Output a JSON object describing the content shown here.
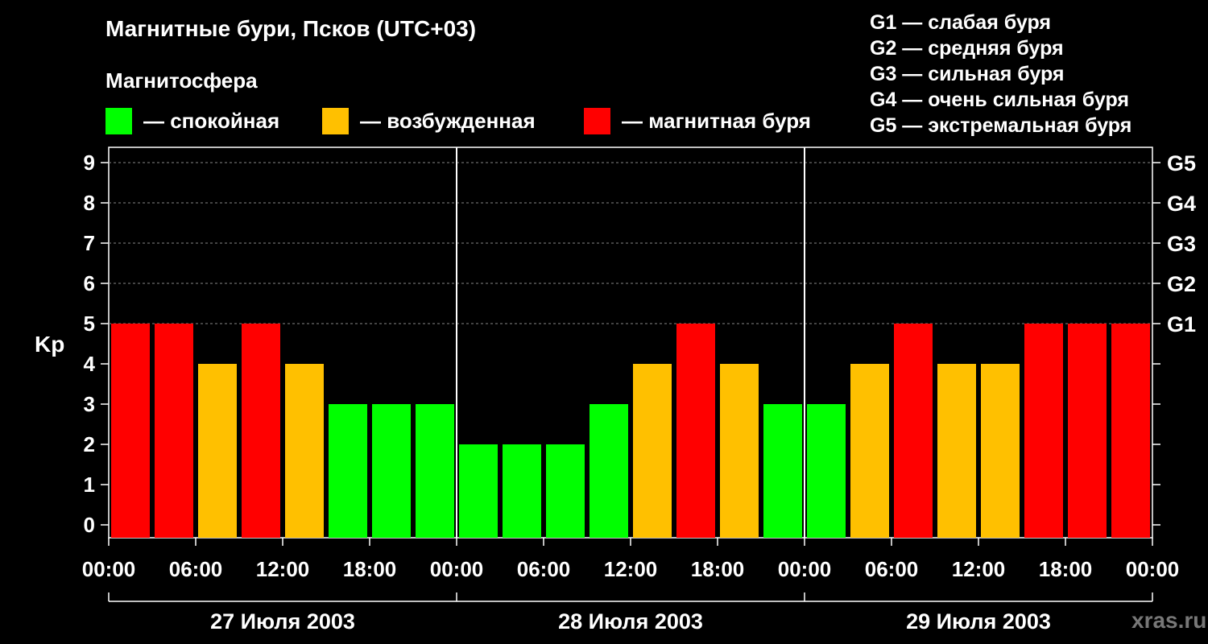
{
  "header": {
    "title": "Магнитные бури, Псков (UTC+03)",
    "magnetosphere_label": "Магнитосфера"
  },
  "legend": {
    "items": [
      {
        "label": "— спокойная",
        "color": "#00ff00"
      },
      {
        "label": "— возбужденная",
        "color": "#ffc000"
      },
      {
        "label": "— магнитная буря",
        "color": "#ff0000"
      }
    ],
    "storm_levels": [
      "G1 — слабая буря",
      "G2 — средняя буря",
      "G3 — сильная буря",
      "G4 — очень сильная буря",
      "G5 — экстремальная буря"
    ]
  },
  "watermark": "xras.ru",
  "colors": {
    "quiet": "#00ff00",
    "active": "#ffc000",
    "storm": "#ff0000",
    "background": "#000000"
  },
  "chart_data": {
    "type": "bar",
    "ylabel": "Kp",
    "ylim": [
      0,
      9
    ],
    "yticks": [
      "0",
      "1",
      "2",
      "3",
      "4",
      "5",
      "6",
      "7",
      "8",
      "9"
    ],
    "g_ticks": [
      {
        "kp": 5,
        "label": "G1"
      },
      {
        "kp": 6,
        "label": "G2"
      },
      {
        "kp": 7,
        "label": "G3"
      },
      {
        "kp": 8,
        "label": "G4"
      },
      {
        "kp": 9,
        "label": "G5"
      }
    ],
    "xticks": [
      "00:00",
      "06:00",
      "12:00",
      "18:00",
      "00:00",
      "06:00",
      "12:00",
      "18:00",
      "00:00",
      "06:00",
      "12:00",
      "18:00",
      "00:00"
    ],
    "days": [
      "27 Июля 2003",
      "28 Июля 2003",
      "29 Июля 2003"
    ],
    "interval_hours": 3,
    "values": [
      5,
      5,
      4,
      5,
      4,
      3,
      3,
      3,
      2,
      2,
      2,
      3,
      4,
      5,
      4,
      3,
      3,
      4,
      5,
      4,
      4,
      5,
      5,
      5
    ],
    "levels": [
      "storm",
      "storm",
      "active",
      "storm",
      "active",
      "quiet",
      "quiet",
      "quiet",
      "quiet",
      "quiet",
      "quiet",
      "quiet",
      "active",
      "storm",
      "active",
      "quiet",
      "quiet",
      "active",
      "storm",
      "active",
      "active",
      "storm",
      "storm",
      "storm"
    ],
    "grid": true
  }
}
